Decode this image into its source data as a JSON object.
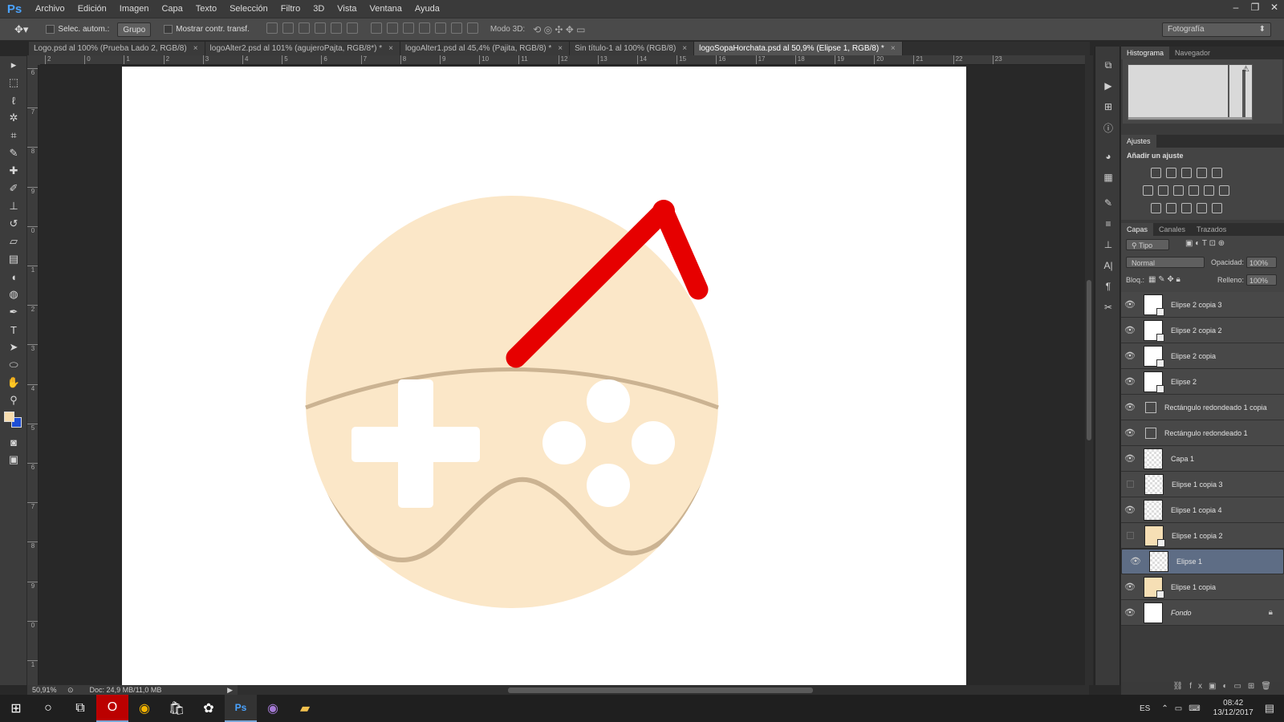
{
  "app": {
    "logo": "Ps"
  },
  "menu": [
    "Archivo",
    "Edición",
    "Imagen",
    "Capa",
    "Texto",
    "Selección",
    "Filtro",
    "3D",
    "Vista",
    "Ventana",
    "Ayuda"
  ],
  "window_controls": [
    "–",
    "❐",
    "✕"
  ],
  "options": {
    "auto_select_label": "Selec. autom.:",
    "auto_select_value": "Grupo",
    "transform_label": "Mostrar contr. transf.",
    "mode3d_label": "Modo 3D:",
    "workspace": "Fotografía"
  },
  "tabs": [
    {
      "label": "Logo.psd al 100% (Prueba Lado 2, RGB/8)",
      "close": "×"
    },
    {
      "label": "logoAlter2.psd al 101% (agujeroPajta, RGB/8*) *",
      "close": "×"
    },
    {
      "label": "logoAlter1.psd al 45,4% (Pajita, RGB/8) *",
      "close": "×"
    },
    {
      "label": "Sin título-1 al 100% (RGB/8)",
      "close": "×"
    },
    {
      "label": "logoSopaHorchata.psd al 50,9% (Elipse 1, RGB/8) *",
      "close": "×"
    }
  ],
  "ruler": {
    "h": [
      "2",
      "0",
      "1",
      "2",
      "3",
      "4",
      "5",
      "6",
      "7",
      "8",
      "9",
      "10",
      "11",
      "12",
      "13",
      "14",
      "15",
      "16",
      "17",
      "18",
      "19",
      "20",
      "21",
      "22",
      "23"
    ],
    "v": [
      "6",
      "7",
      "8",
      "9",
      "0",
      "1",
      "2",
      "3",
      "4",
      "5",
      "6",
      "7",
      "8",
      "9",
      "0",
      "1"
    ]
  },
  "status": {
    "zoom": "50,91%",
    "doc": "Doc: 24,9 MB/11,0 MB"
  },
  "panels": {
    "top_tabs": [
      "Histograma",
      "Navegador"
    ],
    "adjust_tab": "Ajustes",
    "adjust_title": "Añadir un ajuste",
    "layer_tabs": [
      "Capas",
      "Canales",
      "Trazados"
    ],
    "filter_kind": "Tipo",
    "blend_mode": "Normal",
    "opacity_label": "Opacidad:",
    "opacity": "100%",
    "lock_label": "Bloq.:",
    "fill_label": "Relleno:",
    "fill": "100%"
  },
  "layers": [
    {
      "name": "Elipse 2 copia 3",
      "visible": true,
      "thumb": "white",
      "shape": true
    },
    {
      "name": "Elipse 2 copia 2",
      "visible": true,
      "thumb": "white",
      "shape": true
    },
    {
      "name": "Elipse 2 copia",
      "visible": true,
      "thumb": "white",
      "shape": true
    },
    {
      "name": "Elipse 2",
      "visible": true,
      "thumb": "white",
      "shape": true
    },
    {
      "name": "Rectángulo redondeado 1 copia",
      "visible": true,
      "thumb": "none",
      "shape": true
    },
    {
      "name": "Rectángulo redondeado 1",
      "visible": true,
      "thumb": "none",
      "shape": true
    },
    {
      "name": "Capa 1",
      "visible": true,
      "thumb": "check",
      "shape": false
    },
    {
      "name": "Elipse 1 copia 3",
      "visible": false,
      "thumb": "check",
      "shape": false
    },
    {
      "name": "Elipse 1 copia 4",
      "visible": true,
      "thumb": "check",
      "shape": false
    },
    {
      "name": "Elipse 1 copia 2",
      "visible": false,
      "thumb": "cream",
      "shape": true
    },
    {
      "name": "Elipse 1",
      "visible": true,
      "thumb": "check",
      "shape": false,
      "selected": true
    },
    {
      "name": "Elipse 1 copia",
      "visible": true,
      "thumb": "cream",
      "shape": true
    },
    {
      "name": "Fondo",
      "visible": true,
      "thumb": "white",
      "shape": false,
      "locked": true
    }
  ],
  "colors": {
    "cream": "#fbe7c8",
    "outline": "#cbb392",
    "straw": "#e60000",
    "foreground": "#f6dcae",
    "background": "#1f4fd6"
  },
  "taskbar": {
    "lang": "ES",
    "time": "08:42",
    "date": "13/12/2017"
  }
}
